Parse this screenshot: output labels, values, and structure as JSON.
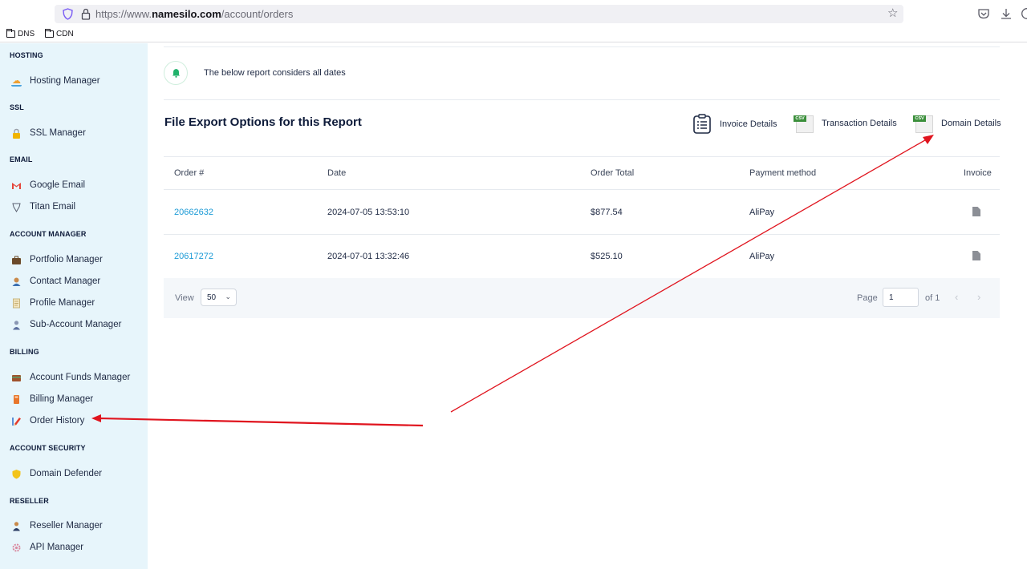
{
  "browser": {
    "url_prefix": "https://www.",
    "url_domain": "namesilo.com",
    "url_path": "/account/orders",
    "bookmarks": [
      "DNS",
      "CDN"
    ]
  },
  "sidebar": {
    "sections": [
      {
        "heading": "HOSTING",
        "items": [
          {
            "label": "Hosting Manager",
            "icon": "hosting-icon"
          }
        ]
      },
      {
        "heading": "SSL",
        "items": [
          {
            "label": "SSL Manager",
            "icon": "lock-icon"
          }
        ]
      },
      {
        "heading": "EMAIL",
        "items": [
          {
            "label": "Google Email",
            "icon": "gmail-icon"
          },
          {
            "label": "Titan Email",
            "icon": "titan-icon"
          }
        ]
      },
      {
        "heading": "ACCOUNT MANAGER",
        "items": [
          {
            "label": "Portfolio Manager",
            "icon": "briefcase-icon"
          },
          {
            "label": "Contact Manager",
            "icon": "contact-icon"
          },
          {
            "label": "Profile Manager",
            "icon": "profile-icon"
          },
          {
            "label": "Sub-Account Manager",
            "icon": "sub-account-icon"
          }
        ]
      },
      {
        "heading": "BILLING",
        "items": [
          {
            "label": "Account Funds Manager",
            "icon": "wallet-icon"
          },
          {
            "label": "Billing Manager",
            "icon": "billing-icon"
          },
          {
            "label": "Order History",
            "icon": "order-history-icon"
          }
        ]
      },
      {
        "heading": "ACCOUNT SECURITY",
        "items": [
          {
            "label": "Domain Defender",
            "icon": "shield-icon"
          }
        ]
      },
      {
        "heading": "RESELLER",
        "items": [
          {
            "label": "Reseller Manager",
            "icon": "reseller-icon"
          },
          {
            "label": "API Manager",
            "icon": "api-icon"
          }
        ]
      }
    ]
  },
  "notice": {
    "text": "The below report considers all dates"
  },
  "export": {
    "title": "File Export Options for this Report",
    "options": [
      {
        "label": "Invoice Details",
        "icon": "invoice-icon"
      },
      {
        "label": "Transaction Details",
        "icon": "csv-icon",
        "badge": "CSV"
      },
      {
        "label": "Domain Details",
        "icon": "csv-icon",
        "badge": "CSV"
      }
    ]
  },
  "table": {
    "headers": [
      "Order #",
      "Date",
      "Order Total",
      "Payment method",
      "Invoice"
    ],
    "rows": [
      {
        "order": "20662632",
        "date": "2024-07-05 13:53:10",
        "total": "$877.54",
        "method": "AliPay"
      },
      {
        "order": "20617272",
        "date": "2024-07-01 13:32:46",
        "total": "$525.10",
        "method": "AliPay"
      }
    ]
  },
  "pagination": {
    "view_label": "View",
    "per_page": "50",
    "page_label": "Page",
    "page": "1",
    "of_label": "of 1"
  },
  "colors": {
    "sidebar_bg": "#e7f5fb",
    "link": "#1b9ad6",
    "annotation_arrow": "#e0141e",
    "success": "#21b26b"
  }
}
